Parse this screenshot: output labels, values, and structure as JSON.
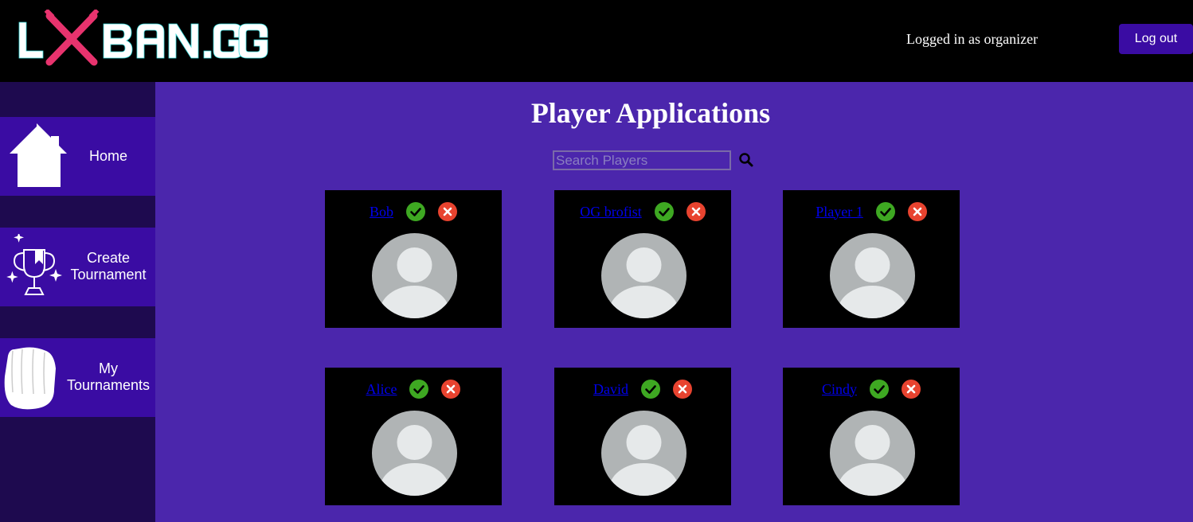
{
  "header": {
    "logo_text": "LXBAN.GG",
    "login_status": "Logged in as organizer",
    "logout_label": "Log out"
  },
  "sidebar": {
    "items": [
      {
        "label": "Home",
        "icon": "home-icon"
      },
      {
        "label": "Create Tournament",
        "icon": "trophy-icon"
      },
      {
        "label": "My Tournaments",
        "icon": "fist-icon"
      }
    ]
  },
  "main": {
    "title": "Player Applications",
    "search": {
      "placeholder": "Search Players"
    },
    "players": [
      {
        "name": "Bob"
      },
      {
        "name": "OG brofist"
      },
      {
        "name": "Player 1"
      },
      {
        "name": "Alice"
      },
      {
        "name": "David"
      },
      {
        "name": "Cindy"
      }
    ]
  },
  "colors": {
    "page_background": "#4b26ac",
    "sidebar_background": "#1e0a4f",
    "nav_item_background": "#3a0ca3",
    "accept": "#3ea822",
    "reject": "#e8432f",
    "logo_accent": "#e8336e"
  }
}
